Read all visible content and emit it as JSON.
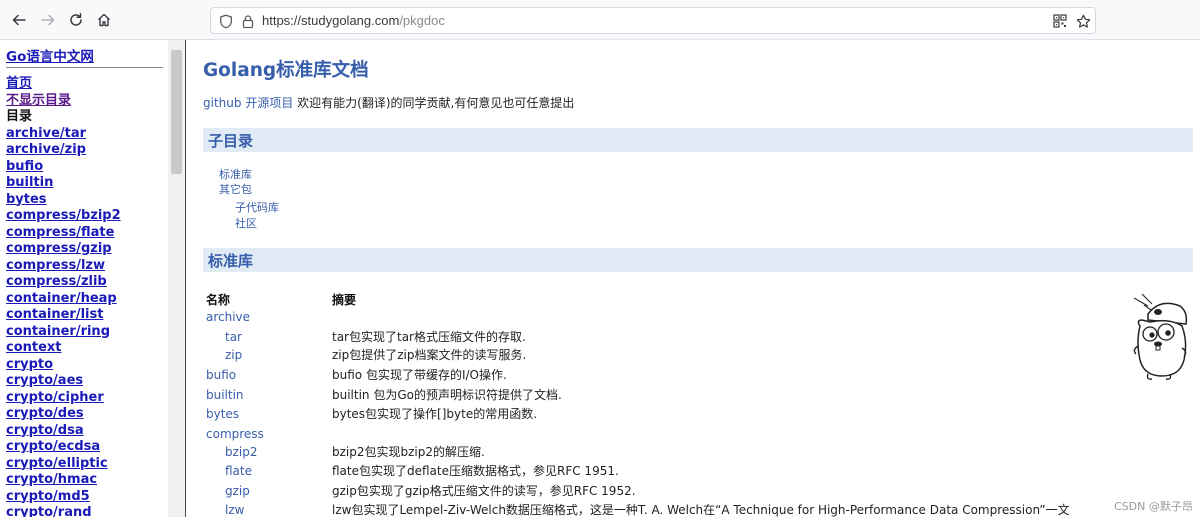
{
  "browser": {
    "url_host": "https://studygolang.com",
    "url_path": "/pkgdoc"
  },
  "sidebar": {
    "site_title": "Go语言中文网",
    "items": [
      {
        "label": "首页",
        "kind": "link"
      },
      {
        "label": "不显示目录",
        "kind": "visited"
      },
      {
        "label": "目录",
        "kind": "static"
      },
      {
        "label": "archive/tar",
        "kind": "link"
      },
      {
        "label": "archive/zip",
        "kind": "link"
      },
      {
        "label": "bufio",
        "kind": "link"
      },
      {
        "label": "builtin",
        "kind": "link"
      },
      {
        "label": "bytes",
        "kind": "link"
      },
      {
        "label": "compress/bzip2",
        "kind": "link"
      },
      {
        "label": "compress/flate",
        "kind": "link"
      },
      {
        "label": "compress/gzip",
        "kind": "link"
      },
      {
        "label": "compress/lzw",
        "kind": "link"
      },
      {
        "label": "compress/zlib",
        "kind": "link"
      },
      {
        "label": "container/heap",
        "kind": "link"
      },
      {
        "label": "container/list",
        "kind": "link"
      },
      {
        "label": "container/ring",
        "kind": "link"
      },
      {
        "label": "context",
        "kind": "link"
      },
      {
        "label": "crypto",
        "kind": "link"
      },
      {
        "label": "crypto/aes",
        "kind": "link"
      },
      {
        "label": "crypto/cipher",
        "kind": "link"
      },
      {
        "label": "crypto/des",
        "kind": "link"
      },
      {
        "label": "crypto/dsa",
        "kind": "link"
      },
      {
        "label": "crypto/ecdsa",
        "kind": "link"
      },
      {
        "label": "crypto/elliptic",
        "kind": "link"
      },
      {
        "label": "crypto/hmac",
        "kind": "link"
      },
      {
        "label": "crypto/md5",
        "kind": "link"
      },
      {
        "label": "crypto/rand",
        "kind": "link"
      }
    ]
  },
  "main": {
    "title": "Golang标准库文档",
    "intro": {
      "github": "github",
      "opensource": "开源项目",
      "text": "欢迎有能力(翻译)的同学贡献,有何意见也可任意提出"
    },
    "subdir_heading": "子目录",
    "subdir_links": [
      "标准库",
      "其它包",
      "子代码库",
      "社区"
    ],
    "stdlib_heading": "标准库",
    "table": {
      "col_name": "名称",
      "col_synopsis": "摘要",
      "rows": [
        {
          "name": "archive",
          "synopsis": ""
        },
        {
          "name": "tar",
          "synopsis": "tar包实现了tar格式压缩文件的存取."
        },
        {
          "name": "zip",
          "synopsis": "zip包提供了zip档案文件的读写服务."
        },
        {
          "name": "bufio",
          "synopsis": "bufio 包实现了带缓存的I/O操作."
        },
        {
          "name": "builtin",
          "synopsis": "builtin 包为Go的预声明标识符提供了文档."
        },
        {
          "name": "bytes",
          "synopsis": "bytes包实现了操作[]byte的常用函数."
        },
        {
          "name": "compress",
          "synopsis": ""
        },
        {
          "name": "bzip2",
          "synopsis": "bzip2包实现bzip2的解压缩."
        },
        {
          "name": "flate",
          "synopsis": "flate包实现了deflate压缩数据格式，参见RFC 1951."
        },
        {
          "name": "gzip",
          "synopsis": "gzip包实现了gzip格式压缩文件的读写，参见RFC 1952."
        },
        {
          "name": "lzw",
          "synopsis": "lzw包实现了Lempel-Ziv-Welch数据压缩格式，这是一种T. A. Welch在“A Technique for High-Performance Data Compression”一文"
        }
      ]
    }
  },
  "watermark": "CSDN @默子昂"
}
